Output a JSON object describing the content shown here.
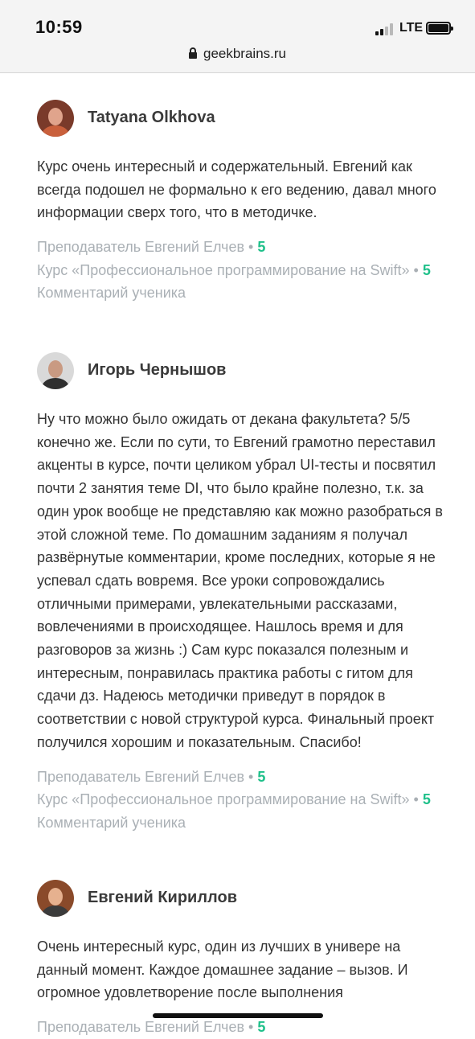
{
  "status_bar": {
    "time": "10:59",
    "network": "LTE"
  },
  "browser": {
    "domain": "geekbrains.ru"
  },
  "colors": {
    "score": "#1fc08a",
    "meta": "#aab0b5",
    "text": "#333333"
  },
  "reviews": [
    {
      "author": "Tatyana Olkhova",
      "avatar": "avatar-photo",
      "text": "Курс очень интересный и содержательный. Евгений как всегда подошел не формально к его ведению, давал много информации сверх того, что в методичке.",
      "teacher_label": "Преподаватель Евгений Елчев",
      "teacher_score": "5",
      "course_label": "Курс «Профессиональное программирование на Swift»",
      "course_score": "5",
      "type_label": "Комментарий ученика"
    },
    {
      "author": "Игорь Чернышов",
      "avatar": "avatar-photo",
      "text": "Ну что можно было ожидать от декана факультета? 5/5 конечно же. Если по сути, то Евгений грамотно переставил акценты в курсе, почти целиком убрал UI-тесты и посвятил почти 2 занятия теме DI, что было крайне полезно, т.к. за один урок вообще не представляю как можно разобраться в этой сложной теме. По домашним заданиям я получал развёрнутые комментарии, кроме последних, которые я не успевал сдать вовремя. Все уроки сопровождались отличными примерами, увлекательными рассказами, вовлечениями в происходящее. Нашлось время и для разговоров за жизнь :) Сам курс показался полезным и интересным, понравилась практика работы с гитом для сдачи дз. Надеюсь методички приведут в порядок в соответствии с новой структурой курса. Финальный проект получился хорошим и показательным. Спасибо!",
      "teacher_label": "Преподаватель Евгений Елчев",
      "teacher_score": "5",
      "course_label": "Курс «Профессиональное программирование на Swift»",
      "course_score": "5",
      "type_label": "Комментарий ученика"
    },
    {
      "author": "Евгений Кириллов",
      "avatar": "avatar-photo",
      "text": "Очень интересный курс, один из лучших в универе на данный момент. Каждое домашнее задание – вызов. И огромное удовлетворение после выполнения",
      "teacher_label": "Преподаватель Евгений Елчев",
      "teacher_score": "5"
    }
  ]
}
